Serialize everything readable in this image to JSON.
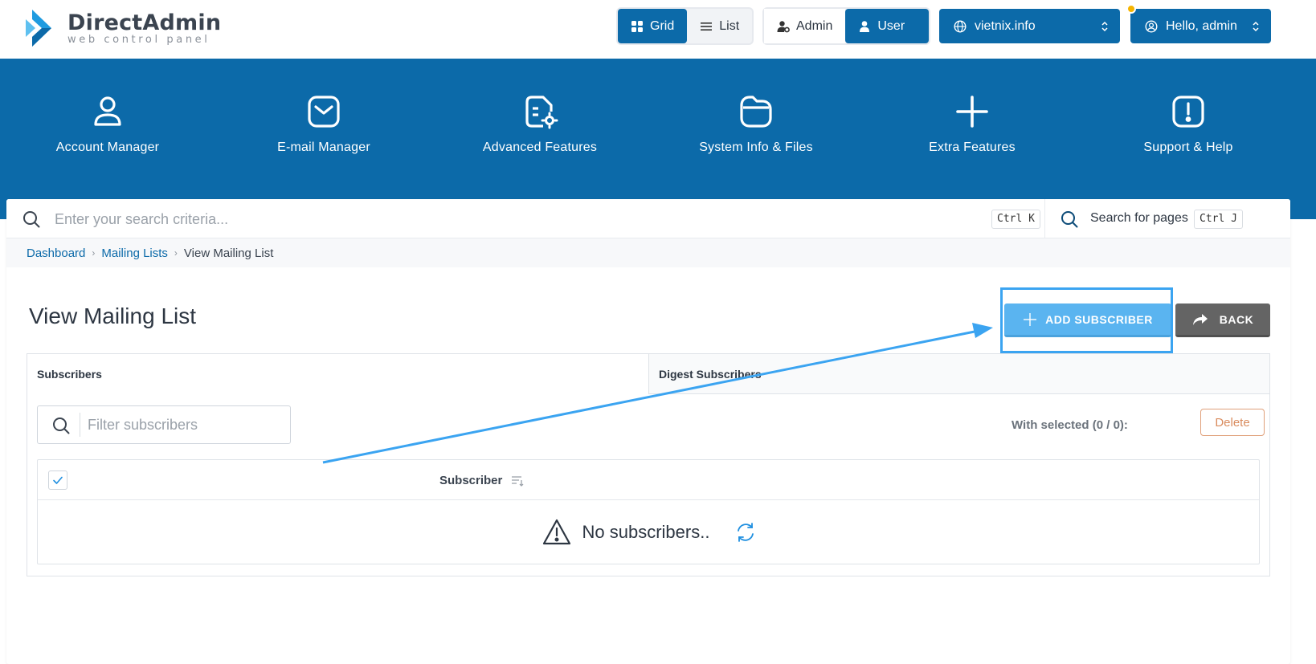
{
  "brand": {
    "title": "DirectAdmin",
    "subtitle": "web control panel"
  },
  "header": {
    "view_toggle": {
      "grid": "Grid",
      "list": "List"
    },
    "role_toggle": {
      "admin": "Admin",
      "user": "User"
    },
    "domain_selector": "vietnix.info",
    "user_menu": "Hello, admin"
  },
  "nav": [
    {
      "label": "Account Manager",
      "icon": "user-icon"
    },
    {
      "label": "E-mail Manager",
      "icon": "mail-icon"
    },
    {
      "label": "Advanced Features",
      "icon": "document-gear-icon"
    },
    {
      "label": "System Info & Files",
      "icon": "folder-icon"
    },
    {
      "label": "Extra Features",
      "icon": "plus-icon"
    },
    {
      "label": "Support & Help",
      "icon": "alert-icon"
    }
  ],
  "search": {
    "placeholder": "Enter your search criteria...",
    "shortcut": "Ctrl K",
    "pages_label": "Search for pages",
    "pages_shortcut": "Ctrl J"
  },
  "breadcrumb": [
    "Dashboard",
    "Mailing Lists",
    "View Mailing List"
  ],
  "page": {
    "title": "View Mailing List",
    "add_button": "ADD SUBSCRIBER",
    "back_button": "BACK"
  },
  "tabs": [
    "Subscribers",
    "Digest Subscribers"
  ],
  "filter": {
    "placeholder": "Filter subscribers"
  },
  "bulk": {
    "with_selected": "With selected (0 / 0):",
    "delete": "Delete"
  },
  "table": {
    "column": "Subscriber",
    "empty_message": "No subscribers.."
  },
  "colors": {
    "primary": "#0c6aa9",
    "add_button": "#5ab4f0",
    "back_button": "#646464",
    "annotation": "#3ba4f1",
    "notification": "#f5b400"
  }
}
